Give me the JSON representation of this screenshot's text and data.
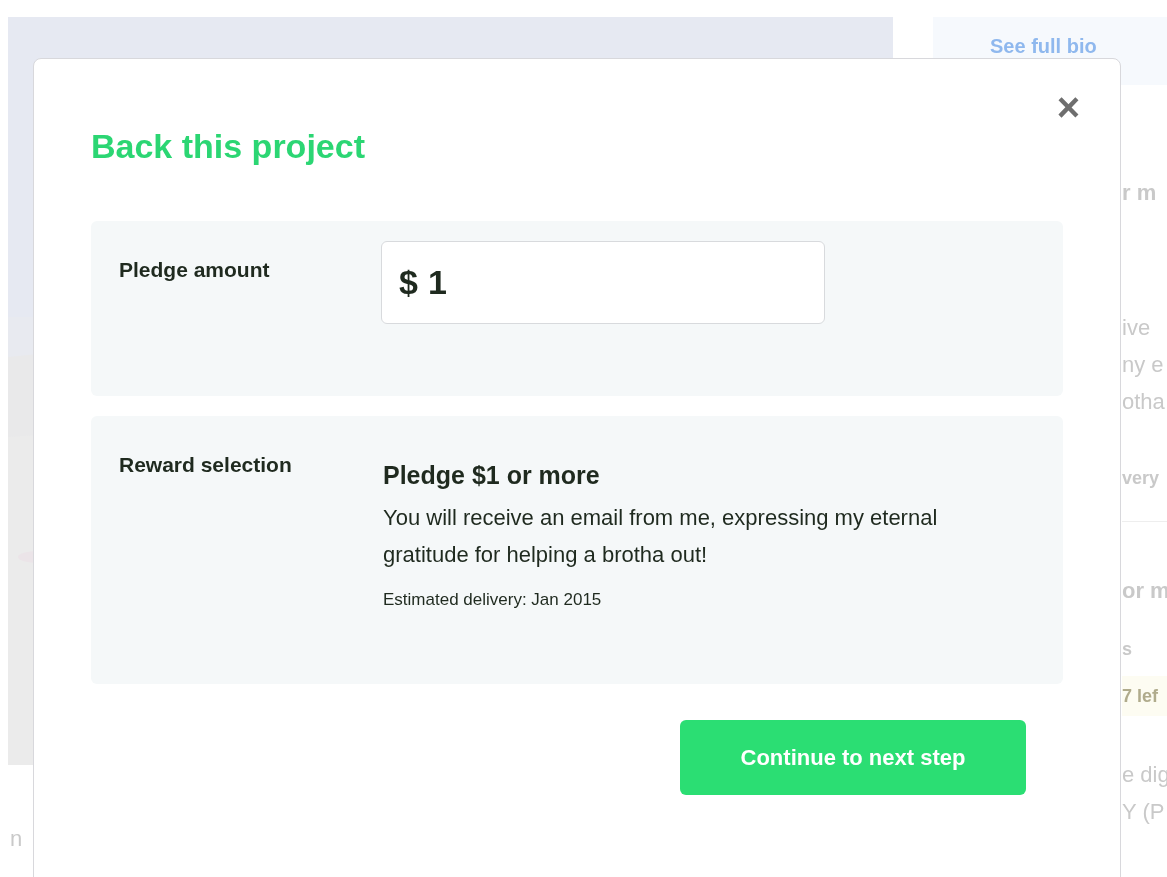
{
  "background": {
    "bio_button": "See full bio",
    "fragments": [
      {
        "kind": "heading",
        "text": "r m"
      },
      {
        "kind": "body",
        "text": "ive"
      },
      {
        "kind": "body",
        "text": "ny e"
      },
      {
        "kind": "body",
        "text": "otha"
      },
      {
        "kind": "small",
        "text": "very"
      },
      {
        "kind": "divider"
      },
      {
        "kind": "heading",
        "text": "or m"
      },
      {
        "kind": "small",
        "text": "s"
      },
      {
        "kind": "badge",
        "text": "7 lef"
      },
      {
        "kind": "body",
        "text": "e dig"
      },
      {
        "kind": "body",
        "text": "Y (P"
      }
    ],
    "left_fragment": "n"
  },
  "modal": {
    "title": "Back this project",
    "close": "×",
    "pledge": {
      "label": "Pledge amount",
      "currency": "$",
      "value": "1"
    },
    "reward": {
      "label": "Reward selection",
      "title": "Pledge $1 or more",
      "description": "You will receive an email from me, expressing my eternal gratitude for helping a brotha out!",
      "delivery": "Estimated delivery: Jan 2015"
    },
    "button": "Continue to next step"
  }
}
